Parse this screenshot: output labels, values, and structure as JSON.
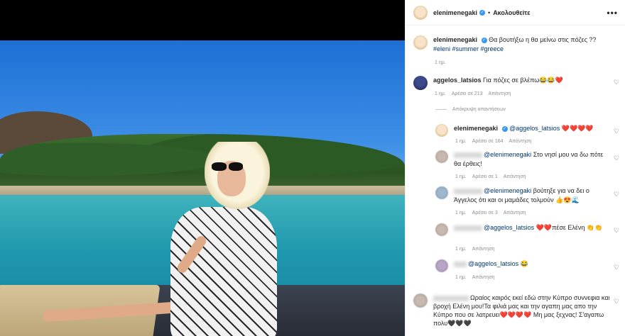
{
  "header": {
    "username": "elenimenegaki",
    "follow_label": "Ακολουθείτε",
    "separator": "•",
    "more_label": "•••"
  },
  "caption": {
    "username": "elenimenegaki",
    "text": "Θα βουτήξω η θα μείνω στις πόζες ?? ",
    "tags": "#eleni #summer #greece",
    "time": "1 ημ."
  },
  "comments": [
    {
      "username": "aggelos_latsios",
      "text": "Για πόζες σε βλέπω😂😂❤️",
      "time": "1 ημ.",
      "likes": "Αρέσει σε 213",
      "reply": "Απάντηση"
    }
  ],
  "hide_replies_label": "Απόκρυψη απαντήσεων",
  "replies": [
    {
      "username": "elenimenegaki",
      "mention": "@aggelos_latsios",
      "text": " ❤️❤️❤️❤️",
      "time": "1 ημ.",
      "likes": "Αρέσει σε 164",
      "reply": "Απάντηση"
    },
    {
      "mention": "@elenimenegaki",
      "text": " Στο νησί μου να δω πότε θα έρθεις!",
      "time": "1 ημ.",
      "likes": "Αρέσει σε 1",
      "reply": "Απάντηση"
    },
    {
      "mention": "@elenimenegaki",
      "text": " βούτηξε για να δει ο Άγγελος ότι και οι μαμάδες τολμούν 👍😍🌊",
      "time": "1 ημ.",
      "likes": "Αρέσει σε 3",
      "reply": "Απάντηση"
    },
    {
      "mention": "@aggelos_latsios",
      "text": " ❤️❤️πέσε Ελένη 👏👏",
      "time": "1 ημ.",
      "reply": "Απάντηση"
    },
    {
      "mention": "@aggelos_latsios",
      "text": " 😂",
      "time": "1 ημ.",
      "reply": "Απάντηση"
    },
    {
      "text": "Ωραίος καιρός εκεί εδώ στην Κύπρο συννεφια και βροχή Ελένη μου!Τα φιλιά μας και την αγαπη μας απο την Κύπρο που σε λατρευει❤️❤️❤️❤️ Μη μας ξεχνας! Σ'αγαπω πολυ🖤🖤🖤"
    }
  ],
  "icons": {
    "heart": "heart-icon",
    "verified": "verified-badge-icon"
  },
  "colors": {
    "link": "#00376b",
    "verified": "#3897f0",
    "muted": "#8e8e8e"
  }
}
